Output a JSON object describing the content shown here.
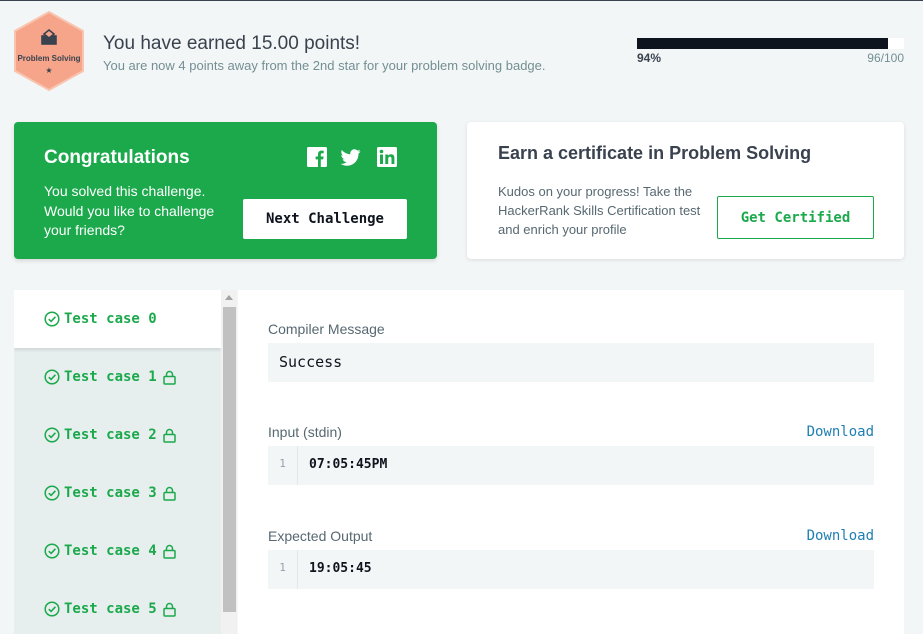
{
  "header": {
    "badge_label": "Problem Solving",
    "badge_star": "★",
    "earned_title": "You have earned 15.00 points!",
    "earned_subtitle": "You are now 4 points away from the 2nd star for your problem solving badge.",
    "progress_percent_label": "94%",
    "progress_count": "96/100",
    "progress_fraction": 0.94
  },
  "congrats": {
    "title": "Congratulations",
    "text": "You solved this challenge. Would you like to challenge your friends?",
    "social_icons": [
      "facebook-icon",
      "twitter-icon",
      "linkedin-icon"
    ],
    "next_button": "Next Challenge"
  },
  "certificate": {
    "title": "Earn a certificate in Problem Solving",
    "text": "Kudos on your progress! Take the HackerRank Skills Certification test and enrich your profile",
    "button": "Get Certified"
  },
  "test_cases": [
    {
      "label": "Test case 0",
      "locked": false,
      "active": true
    },
    {
      "label": "Test case 1",
      "locked": true,
      "active": false
    },
    {
      "label": "Test case 2",
      "locked": true,
      "active": false
    },
    {
      "label": "Test case 3",
      "locked": true,
      "active": false
    },
    {
      "label": "Test case 4",
      "locked": true,
      "active": false
    },
    {
      "label": "Test case 5",
      "locked": true,
      "active": false
    }
  ],
  "result": {
    "compiler_label": "Compiler Message",
    "compiler_message": "Success",
    "input_label": "Input (stdin)",
    "input_line_no": "1",
    "input_value": "07:05:45PM",
    "expected_label": "Expected Output",
    "expected_line_no": "1",
    "expected_value": "19:05:45",
    "download_label": "Download"
  },
  "colors": {
    "accent_green": "#1ba94c",
    "link_blue": "#1f7eb4",
    "badge_orange": "#f6a58a",
    "dark": "#0e141e"
  }
}
